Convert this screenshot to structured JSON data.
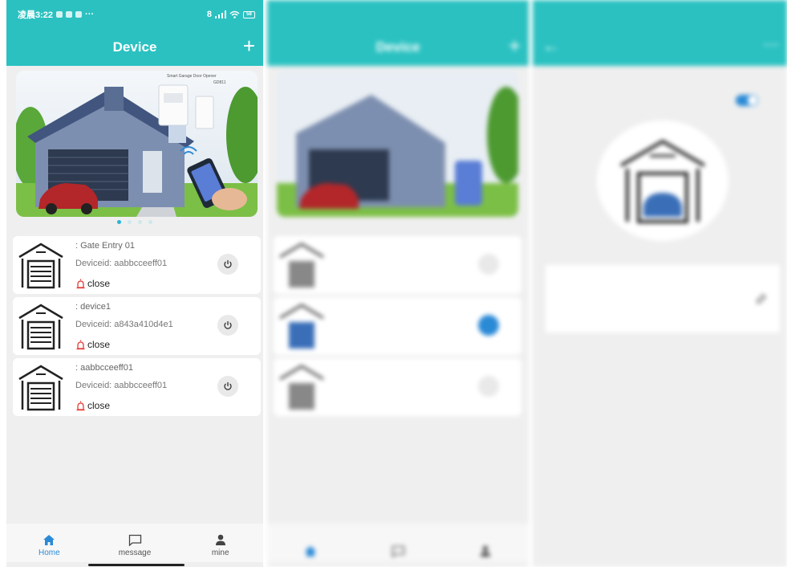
{
  "status": {
    "time": "凌晨3:22",
    "more": "···",
    "net": "8",
    "battery": "58"
  },
  "header": {
    "title": "Device",
    "add_label": "+"
  },
  "banner": {
    "brand": "Smart Garage Door Opener",
    "model": "GD811",
    "slides": 4,
    "active_slide": 0
  },
  "devices": [
    {
      "name": ": Gate Entry 01",
      "deviceid": "Deviceid: aabbcceeff01",
      "status": "close",
      "power_on": false
    },
    {
      "name": ": device1",
      "deviceid": "Deviceid: a843a410d4e1",
      "status": "close",
      "power_on": false
    },
    {
      "name": ": aabbcceeff01",
      "deviceid": "Deviceid: aabbcceeff01",
      "status": "close",
      "power_on": false
    }
  ],
  "tabs": [
    {
      "label": "Home",
      "icon": "home-icon",
      "active": true
    },
    {
      "label": "message",
      "icon": "message-icon",
      "active": false
    },
    {
      "label": "mine",
      "icon": "person-icon",
      "active": false
    }
  ],
  "blurred": {
    "second_title": "Device",
    "third_title": "",
    "colors": {
      "teal": "#2bc1c1",
      "blue": "#2b8ad6",
      "alarm": "#e53935"
    }
  }
}
